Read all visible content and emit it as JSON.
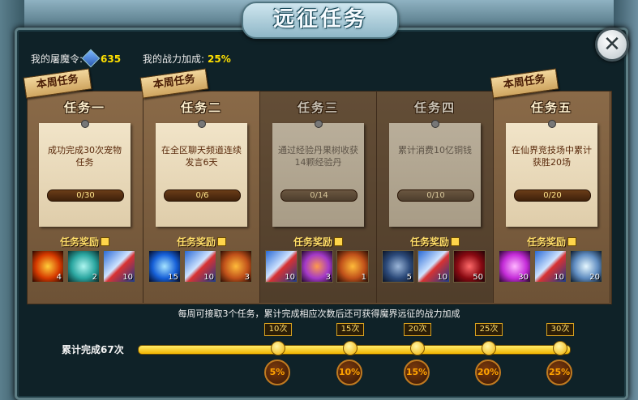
{
  "title": "远征任务",
  "close_label": "✕",
  "header": {
    "token_label": "我的屠魔令:",
    "token_value": "635",
    "power_label": "我的战力加成:",
    "power_value": "25%"
  },
  "week_tag": "本周任务",
  "reward_label": "任务奖励",
  "tasks": [
    {
      "name": "任务一",
      "weekly": true,
      "desc": "成功完成30次宠物任务",
      "progress": "0/30",
      "dim": false,
      "rewards": [
        {
          "icon": "fire-orb-icon",
          "count": "4"
        },
        {
          "icon": "beast-icon",
          "count": "2"
        },
        {
          "icon": "scroll-icon",
          "count": "10"
        }
      ]
    },
    {
      "name": "任务二",
      "weekly": true,
      "desc": "在全区聊天频道连续发言6天",
      "progress": "0/6",
      "dim": false,
      "rewards": [
        {
          "icon": "blue-flame-icon",
          "count": "15"
        },
        {
          "icon": "scroll-icon",
          "count": "10"
        },
        {
          "icon": "pot-icon",
          "count": "3"
        }
      ]
    },
    {
      "name": "任务三",
      "weekly": false,
      "desc": "通过经验丹果树收获14颗经验丹",
      "progress": "0/14",
      "dim": true,
      "rewards": [
        {
          "icon": "scroll-icon",
          "count": "10"
        },
        {
          "icon": "purple-pot-icon",
          "count": "3"
        },
        {
          "icon": "pot-icon",
          "count": "1"
        }
      ]
    },
    {
      "name": "任务四",
      "weekly": false,
      "desc": "累计消费10亿铜钱",
      "progress": "0/10",
      "dim": true,
      "rewards": [
        {
          "icon": "armor-icon",
          "count": "5"
        },
        {
          "icon": "scroll-icon",
          "count": "10"
        },
        {
          "icon": "red-crystal-icon",
          "count": "50"
        }
      ]
    },
    {
      "name": "任务五",
      "weekly": true,
      "desc": "在仙界竞技场中累计获胜20场",
      "progress": "0/20",
      "dim": false,
      "rewards": [
        {
          "icon": "purple-orb-icon",
          "count": "30"
        },
        {
          "icon": "scroll-icon",
          "count": "10"
        },
        {
          "icon": "ice-crystal-icon",
          "count": "20"
        }
      ]
    }
  ],
  "footer_note": "每周可接取3个任务，累计完成相应次数后还可获得魔界远征的战力加成",
  "total_label": "累计完成67次",
  "milestones": [
    {
      "count": "10次",
      "bonus": "5%"
    },
    {
      "count": "15次",
      "bonus": "10%"
    },
    {
      "count": "20次",
      "bonus": "15%"
    },
    {
      "count": "25次",
      "bonus": "20%"
    },
    {
      "count": "30次",
      "bonus": "25%"
    }
  ],
  "colors": {
    "accent": "#ffe000",
    "gold": "#ffde6a",
    "frame": "#0f2228"
  }
}
